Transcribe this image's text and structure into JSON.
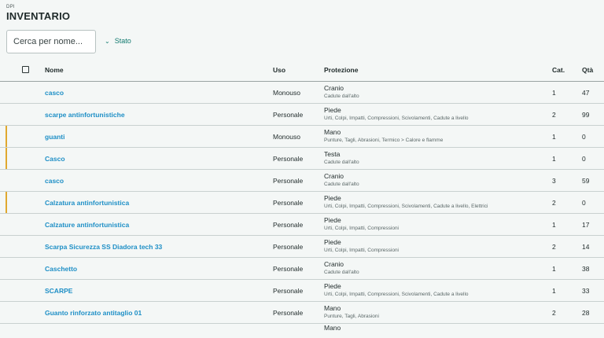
{
  "header": {
    "kicker": "DPI",
    "title": "INVENTARIO"
  },
  "search": {
    "placeholder": "Cerca per nome..."
  },
  "filter": {
    "label": "Stato"
  },
  "columns": {
    "name": "Nome",
    "uso": "Uso",
    "protezione": "Protezione",
    "cat": "Cat.",
    "qta": "Qtà"
  },
  "rows": [
    {
      "name": "casco",
      "uso": "Monouso",
      "prot_main": "Cranio",
      "prot_sub": "Cadute dall'alto",
      "cat": "1",
      "qta": "47",
      "flag": false
    },
    {
      "name": "scarpe antinfortunistiche",
      "uso": "Personale",
      "prot_main": "Piede",
      "prot_sub": "Urti, Colpi, Impatti, Compressioni, Scivolamenti, Cadute a livello",
      "cat": "2",
      "qta": "99",
      "flag": false
    },
    {
      "name": "guanti",
      "uso": "Monouso",
      "prot_main": "Mano",
      "prot_sub": "Punture, Tagli, Abrasioni, Termico > Calore e flamme",
      "cat": "1",
      "qta": "0",
      "flag": true
    },
    {
      "name": "Casco",
      "uso": "Personale",
      "prot_main": "Testa",
      "prot_sub": "Cadute dall'alto",
      "cat": "1",
      "qta": "0",
      "flag": true
    },
    {
      "name": "casco",
      "uso": "Personale",
      "prot_main": "Cranio",
      "prot_sub": "Cadute dall'alto",
      "cat": "3",
      "qta": "59",
      "flag": false
    },
    {
      "name": "Calzatura antinfortunistica",
      "uso": "Personale",
      "prot_main": "Piede",
      "prot_sub": "Urti, Colpi, Impatti, Compressioni, Scivolamenti, Cadute a livello, Elettrici",
      "cat": "2",
      "qta": "0",
      "flag": true
    },
    {
      "name": "Calzature antinfortunistica",
      "uso": "Personale",
      "prot_main": "Piede",
      "prot_sub": "Urti, Colpi, Impatti, Compressioni",
      "cat": "1",
      "qta": "17",
      "flag": false
    },
    {
      "name": "Scarpa Sicurezza SS Diadora tech 33",
      "uso": "Personale",
      "prot_main": "Piede",
      "prot_sub": "Urti, Colpi, Impatti, Compressioni",
      "cat": "2",
      "qta": "14",
      "flag": false
    },
    {
      "name": "Caschetto",
      "uso": "Personale",
      "prot_main": "Cranio",
      "prot_sub": "Cadute dall'alto",
      "cat": "1",
      "qta": "38",
      "flag": false
    },
    {
      "name": "SCARPE",
      "uso": "Personale",
      "prot_main": "Piede",
      "prot_sub": "Urti, Colpi, Impatti, Compressioni, Scivolamenti, Cadute a livello",
      "cat": "1",
      "qta": "33",
      "flag": false
    },
    {
      "name": "Guanto rinforzato antitaglio 01",
      "uso": "Personale",
      "prot_main": "Mano",
      "prot_sub": "Punture, Tagli, Abrasioni",
      "cat": "2",
      "qta": "28",
      "flag": false
    }
  ],
  "partial_row": {
    "prot_main": "Mano"
  }
}
